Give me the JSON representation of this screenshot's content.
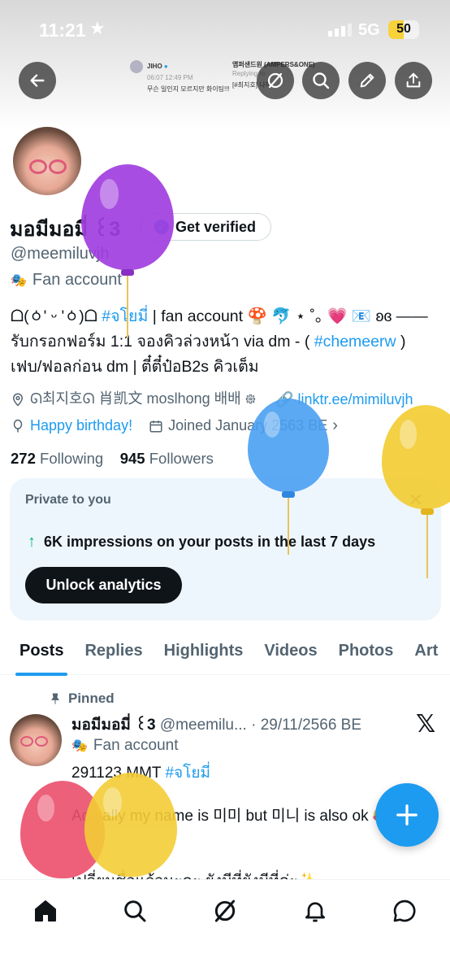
{
  "status_bar": {
    "time": "11:21",
    "network": "5G",
    "battery": "50",
    "battery_level_percent": 50
  },
  "banner": {
    "card1_name": "JIHO",
    "card1_time": "06:07 12:49 PM",
    "card1_text": "무슨 일인지 모르지만 화이팅!!!",
    "card2_name": "앰퍼샌드원 (AMPERS&ONE)",
    "card2_reply": "Replying to",
    "card2_text": "[#최지호] 나히"
  },
  "profile": {
    "name": "มอมีมอมี่ ꒰3",
    "get_verified": "Get verified",
    "handle": "@meemiluvjh",
    "fan_account": "Fan account",
    "bio_line1_prefix": "ᗝ(ㆁ' ᵕ 'ㆁ)ᗝ ",
    "bio_tag": "#จโยมี่",
    "bio_line1_suffix": " | fan account 🍄 🐬 ⋆ ˚｡ 💗 📧 ʚɞ ——",
    "bio_line2_prefix": "รับกรอกฟอร์ม 1:1 จองคิวล่วงหน้า via dm - ( ",
    "bio_link": "#chemeerw",
    "bio_line2_suffix": " )",
    "bio_line3": "เฟบ/ฟอลก่อน dm | ตี๋ตี๋ป๋อB2s คิวเต็ม",
    "location": "ᘏ최지호ᘏ 肖凯文 moslhong 배배 ᪥",
    "website": "linktr.ee/mimiluvjh",
    "birthday": "Happy birthday!",
    "joined": "Joined January 2563 BE",
    "following_count": "272",
    "following_label": "Following",
    "followers_count": "945",
    "followers_label": "Followers"
  },
  "private_card": {
    "label": "Private to you",
    "impressions": "6K impressions on your posts in the last 7 days",
    "unlock": "Unlock analytics"
  },
  "tabs": [
    "Posts",
    "Replies",
    "Highlights",
    "Videos",
    "Photos",
    "Art"
  ],
  "post": {
    "pinned": "Pinned",
    "author": "มอมีมอมี่ ꒰3",
    "handle_date": "@meemilu... · 29/11/2566 BE",
    "fan_account": "Fan account",
    "text1_prefix": "291123 MMT ",
    "text1_tag": "#จโยมี่",
    "text2": "Actually my name is 미미 but 미니 is also ok 🥰",
    "text3": "เปลี่ยนชื่อแล้วนะคะ ยังมีที่ยังมีที่ค่ะ✨"
  },
  "colors": {
    "accent": "#1d9bf0",
    "balloon_purple": "#a13ee0",
    "balloon_blue": "#4aa0f2",
    "balloon_yellow": "#f3cd35",
    "balloon_red": "#ec4f6c"
  },
  "icons": {
    "back": "arrow-left-icon",
    "spaces": "grok-icon",
    "search": "search-icon",
    "edit": "pencil-icon",
    "share": "share-icon",
    "home": "home-icon",
    "explore": "search-icon",
    "grok": "grok-icon",
    "notifications": "bell-icon",
    "messages": "chat-bubble-icon"
  }
}
